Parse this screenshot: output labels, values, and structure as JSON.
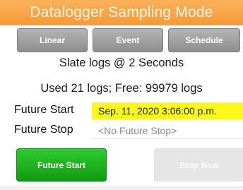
{
  "title": "Datalogger Sampling Mode",
  "modes": {
    "linear": "Linear",
    "event": "Event",
    "schedule": "Schedule"
  },
  "status": {
    "rate": "Slate logs @  2 Seconds",
    "usage": "Used 21 logs; Free: 99979 logs"
  },
  "fields": {
    "future_start_label": "Future Start",
    "future_start_value": "Sep. 11, 2020 3:06:00 p.m.",
    "future_stop_label": "Future Stop",
    "future_stop_placeholder": "<No Future Stop>"
  },
  "actions": {
    "future_start": "Future Start",
    "stop_now": "Stop Now"
  },
  "colors": {
    "title_bar": "#f7a545",
    "mode_button": "#a0a0a0",
    "start_highlight": "#fff91a",
    "future_start_button": "#1fb31f",
    "disabled_button": "#e6e6e6"
  }
}
